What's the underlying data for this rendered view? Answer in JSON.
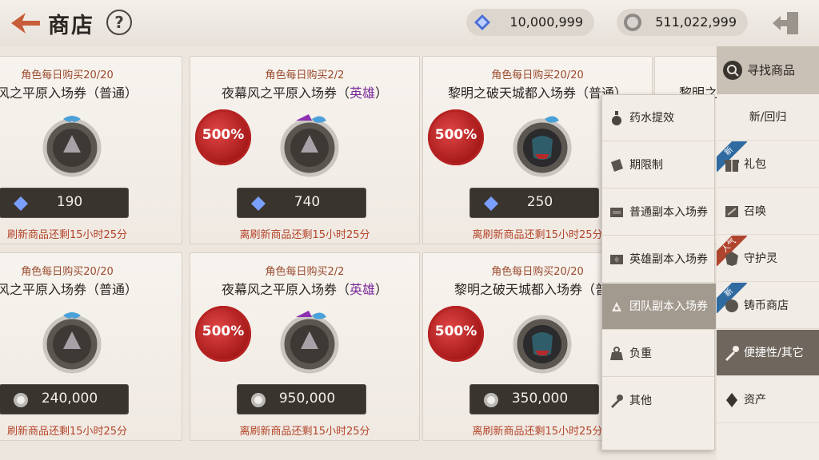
{
  "header": {
    "title": "商店",
    "help_label": "?",
    "currency_gem": "10,000,999",
    "currency_coin": "511,022,999"
  },
  "cards": [
    {
      "limit": "角色每日购买20/20",
      "name": "风之平原入场券（普通）",
      "hero_suffix": "",
      "discount": "",
      "price": "190",
      "price_icon": "gem-icon",
      "timer": "刷新商品还剩15小时25分"
    },
    {
      "limit": "角色每日购买2/2",
      "name": "夜幕风之平原入场券（",
      "hero_suffix": "英雄",
      "discount": "500%",
      "price": "740",
      "price_icon": "gem-icon",
      "timer": "离刷新商品还剩15小时25分"
    },
    {
      "limit": "角色每日购买20/20",
      "name": "黎明之破天城都入场券（普通）",
      "hero_suffix": "",
      "discount": "500%",
      "price": "250",
      "price_icon": "gem-icon",
      "timer": "离刷新商品还剩15小时25分"
    },
    {
      "limit": "",
      "name": "黎明之",
      "hero_suffix": "",
      "discount": "",
      "price": "",
      "price_icon": "",
      "timer": ""
    },
    {
      "limit": "角色每日购买20/20",
      "name": "风之平原入场券（普通）",
      "hero_suffix": "",
      "discount": "",
      "price": "240,000",
      "price_icon": "coin-icon",
      "timer": "刷新商品还剩15小时25分"
    },
    {
      "limit": "角色每日购买2/2",
      "name": "夜幕风之平原入场券（",
      "hero_suffix": "英雄",
      "discount": "500%",
      "price": "950,000",
      "price_icon": "coin-icon",
      "timer": "离刷新商品还剩15小时25分"
    },
    {
      "limit": "角色每日购买20/20",
      "name": "黎明之破天城都入场券（普通",
      "hero_suffix": "",
      "discount": "500%",
      "price": "350,000",
      "price_icon": "coin-icon",
      "timer": "离刷新商品还剩15小时25分"
    }
  ],
  "dropdown": {
    "items": [
      {
        "label": "药水提效",
        "icon": "potion-icon"
      },
      {
        "label": "期限制",
        "icon": "timer-icon"
      },
      {
        "label": "普通副本入场券",
        "icon": "ticket-icon"
      },
      {
        "label": "英雄副本入场券",
        "icon": "hero-ticket-icon"
      },
      {
        "label": "团队副本入场券",
        "icon": "team-ticket-icon",
        "active": true
      },
      {
        "label": "负重",
        "icon": "weight-icon"
      },
      {
        "label": "其他",
        "icon": "misc-icon"
      }
    ]
  },
  "sidebar": {
    "search_label": "寻找商品",
    "items": [
      {
        "label": "新/回归",
        "icon": ""
      },
      {
        "label": "礼包",
        "icon": "gift-icon",
        "badge": "新"
      },
      {
        "label": "召唤",
        "icon": "summon-icon"
      },
      {
        "label": "守护灵",
        "icon": "guardian-icon",
        "badge": "人气"
      },
      {
        "label": "铸币商店",
        "icon": "mint-icon",
        "badge": "新"
      },
      {
        "label": "便捷性/其它",
        "icon": "convenience-icon",
        "active": true
      },
      {
        "label": "资产",
        "icon": "asset-icon"
      }
    ]
  },
  "colors": {
    "accent": "#b5452a",
    "hero": "#7a2a9a",
    "seal": "#b62222",
    "active_tab": "#6f675e"
  }
}
